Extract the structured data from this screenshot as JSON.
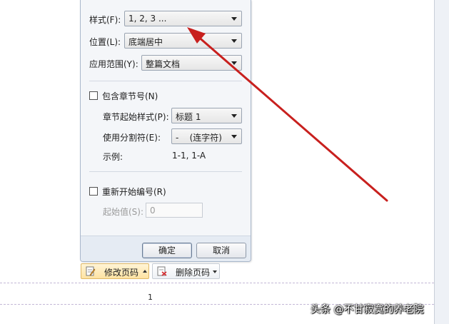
{
  "dialog": {
    "format": {
      "label": "样式(F):",
      "value": "1, 2, 3 ..."
    },
    "position": {
      "label": "位置(L):",
      "value": "底端居中"
    },
    "apply_to": {
      "label": "应用范围(Y):",
      "value": "整篇文档"
    },
    "include_chapter": {
      "label": "包含章节号(N)",
      "checked": false
    },
    "chapter_style": {
      "label": "章节起始样式(P):",
      "value": "标题 1"
    },
    "separator": {
      "label": "使用分割符(E):",
      "value": "-    (连字符)"
    },
    "example": {
      "label": "示例:",
      "value": "1-1, 1-A"
    },
    "restart": {
      "label": "重新开始编号(R)",
      "checked": false
    },
    "start_at": {
      "label": "起始值(S):",
      "value": "0"
    },
    "ok_label": "确定",
    "cancel_label": "取消"
  },
  "toolbar": {
    "edit_page_number": "修改页码",
    "delete_page_number": "删除页码"
  },
  "page": {
    "page_number": "1"
  },
  "watermark": "头条 @不甘寂寞的养老院",
  "colors": {
    "annotation_arrow": "#c8201e",
    "dialog_bg": "#f4f6f9",
    "footer_bg": "#e5ebf3"
  }
}
